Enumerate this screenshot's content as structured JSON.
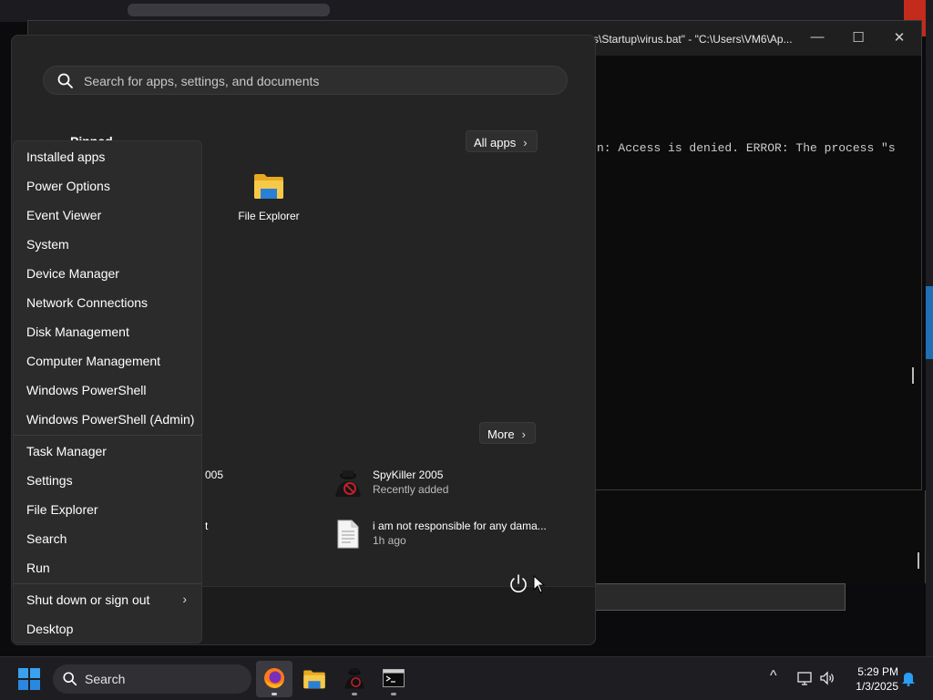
{
  "console": {
    "title": "s\\Startup\\virus.bat\" - \"C:\\Users\\VM6\\Ap...",
    "minimize": "—",
    "maximize": "☐",
    "close": "✕",
    "output_line": "n: Access is denied.  ERROR: The process \"s"
  },
  "start_menu": {
    "search_placeholder": "Search for apps, settings, and documents",
    "pinned_label": "Pinned",
    "all_apps_label": "All apps",
    "pinned_apps": [
      {
        "label": "File Explorer",
        "icon": "folder-icon"
      }
    ],
    "recommended_more_label": "More",
    "recommended": [
      {
        "name": "SpyKiller 2005",
        "sub": "Recently added",
        "icon": "spy-icon"
      },
      {
        "name": "i am not responsible for any dama...",
        "sub": "1h ago",
        "icon": "document-icon"
      }
    ],
    "recommended_left_fragments": [
      "005",
      "t"
    ],
    "power_icon": "power-icon"
  },
  "winx_menu": {
    "items": [
      "Installed apps",
      "Power Options",
      "Event Viewer",
      "System",
      "Device Manager",
      "Network Connections",
      "Disk Management",
      "Computer Management",
      "Windows PowerShell",
      "Windows PowerShell (Admin)",
      "Task Manager",
      "Settings",
      "File Explorer",
      "Search",
      "Run",
      "Shut down or sign out",
      "Desktop"
    ],
    "submenu_arrow": "›"
  },
  "taskbar": {
    "search_placeholder": "Search",
    "apps": [
      "firefox-icon",
      "file-explorer-icon",
      "spykiller-icon",
      "terminal-icon"
    ],
    "tray_chevron": "^",
    "time": "5:29 PM",
    "date": "1/3/2025"
  },
  "colors": {
    "accent_blue": "#2a9df4",
    "folder_yellow": "#f7c948",
    "close_red": "#c42b1c"
  }
}
